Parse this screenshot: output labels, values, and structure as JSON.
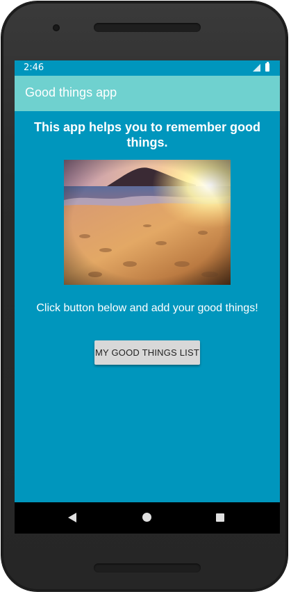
{
  "status_bar": {
    "time": "2:46",
    "signal_icon": "cell-signal-icon",
    "battery_icon": "battery-icon"
  },
  "app_bar": {
    "title": "Good things app"
  },
  "main": {
    "headline": "This app helps you to remember good things.",
    "image_icon": "beach-sunset-image",
    "instruction": "Click button below and add your good things!",
    "button_label": "MY GOOD THINGS LIST"
  },
  "nav_bar": {
    "back_icon": "back-triangle-icon",
    "home_icon": "home-circle-icon",
    "recents_icon": "recents-square-icon"
  },
  "colors": {
    "screen_background": "#0096bd",
    "app_bar": "#6fd1cf",
    "button": "#d8d8d8",
    "text": "#ffffff"
  }
}
